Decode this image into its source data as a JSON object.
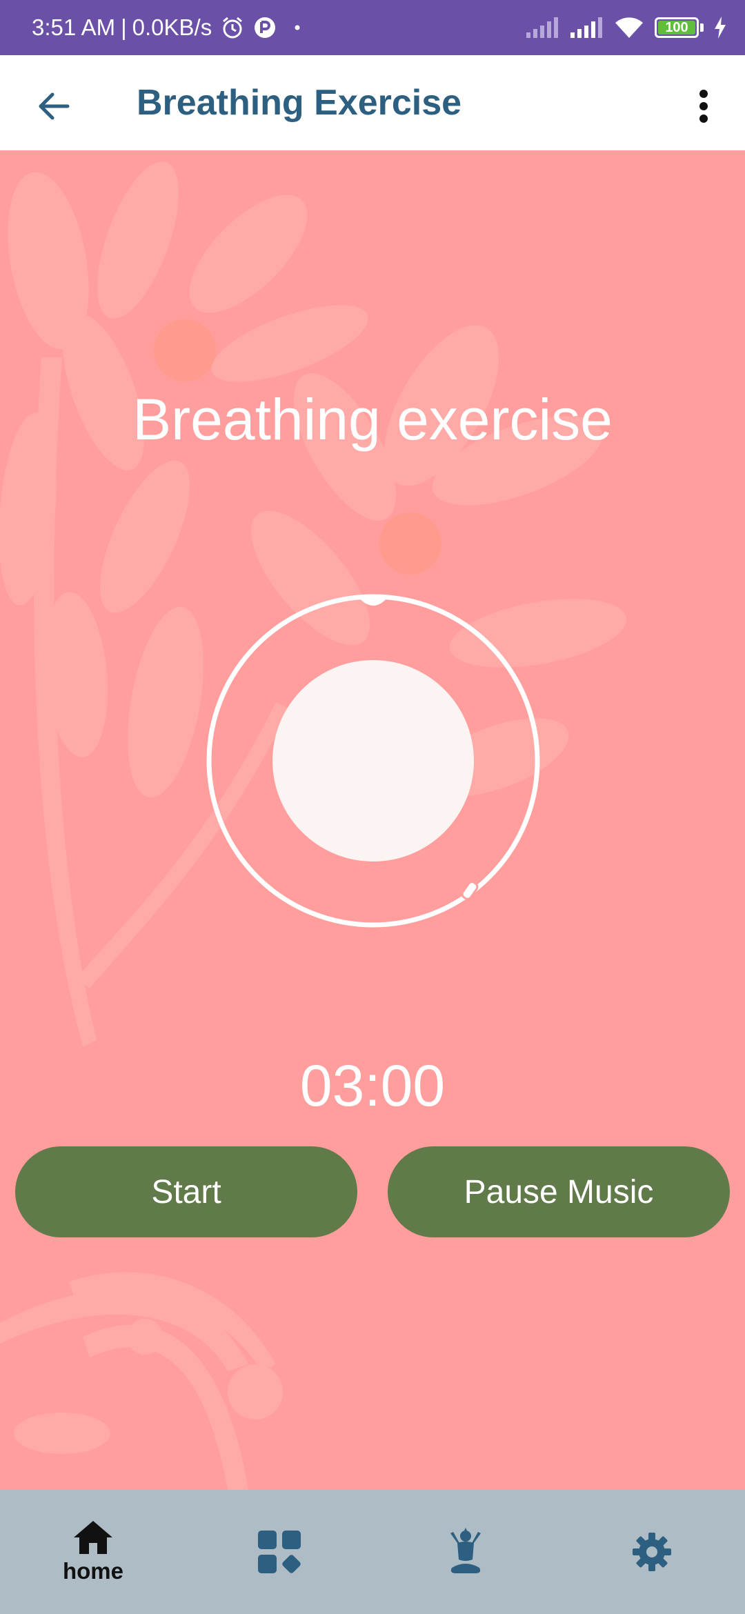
{
  "status_bar": {
    "time": "3:51 AM",
    "separator": "|",
    "speed": "0.0KB/s",
    "battery": "100",
    "icons": [
      "alarm-icon",
      "app-notification-icon",
      "dot-icon",
      "signal-icon",
      "signal-icon",
      "wifi-icon",
      "battery-icon",
      "charging-icon"
    ]
  },
  "app_bar": {
    "title": "Breathing Exercise",
    "back_icon": "arrow-left-icon",
    "menu_icon": "more-vert-icon"
  },
  "main": {
    "heading": "Breathing exercise",
    "timer": "03:00",
    "start_label": "Start",
    "pause_label": "Pause Music"
  },
  "bottom_nav": {
    "items": [
      {
        "icon": "home-icon",
        "label": "home"
      },
      {
        "icon": "dashboard-icon",
        "label": ""
      },
      {
        "icon": "meditation-icon",
        "label": ""
      },
      {
        "icon": "settings-icon",
        "label": ""
      }
    ]
  },
  "colors": {
    "status_bar": "#6a50a7",
    "app_bar_bg": "#ffffff",
    "title": "#2d5f80",
    "background": "#ff9e9c",
    "button": "#617a4a",
    "nav_bg": "#aebcc6",
    "nav_icon": "#2d5f80"
  }
}
